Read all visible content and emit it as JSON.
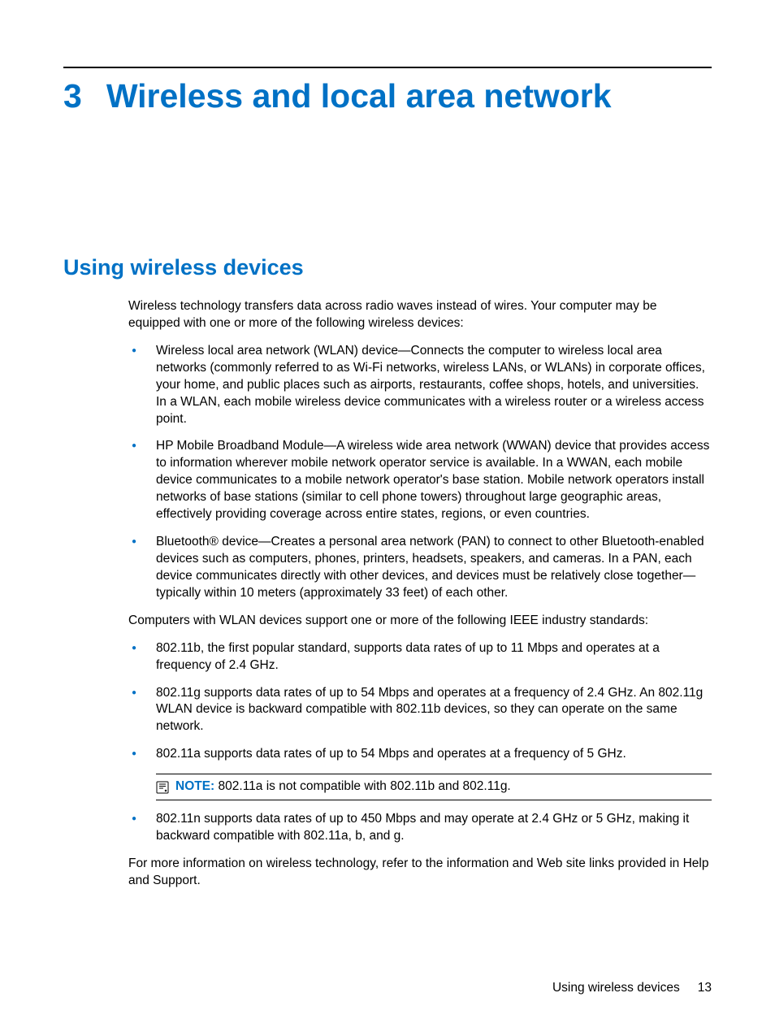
{
  "chapter": {
    "number": "3",
    "title": "Wireless and local area network"
  },
  "section": {
    "title": "Using wireless devices",
    "intro": "Wireless technology transfers data across radio waves instead of wires. Your computer may be equipped with one or more of the following wireless devices:",
    "devices": [
      "Wireless local area network (WLAN) device—Connects the computer to wireless local area networks (commonly referred to as Wi-Fi networks, wireless LANs, or WLANs) in corporate offices, your home, and public places such as airports, restaurants, coffee shops, hotels, and universities. In a WLAN, each mobile wireless device communicates with a wireless router or a wireless access point.",
      "HP Mobile Broadband Module—A wireless wide area network (WWAN) device that provides access to information wherever mobile network operator service is available. In a WWAN, each mobile device communicates to a mobile network operator's base station. Mobile network operators install networks of base stations (similar to cell phone towers) throughout large geographic areas, effectively providing coverage across entire states, regions, or even countries.",
      "Bluetooth® device—Creates a personal area network (PAN) to connect to other Bluetooth-enabled devices such as computers, phones, printers, headsets, speakers, and cameras. In a PAN, each device communicates directly with other devices, and devices must be relatively close together—typically within 10 meters (approximately 33 feet) of each other."
    ],
    "standards_intro": "Computers with WLAN devices support one or more of the following IEEE industry standards:",
    "standards": [
      "802.11b, the first popular standard, supports data rates of up to 11 Mbps and operates at a frequency of 2.4 GHz.",
      "802.11g supports data rates of up to 54 Mbps and operates at a frequency of 2.4 GHz. An 802.11g WLAN device is backward compatible with 802.11b devices, so they can operate on the same network.",
      "802.11a supports data rates of up to 54 Mbps and operates at a frequency of 5 GHz.",
      "802.11n supports data rates of up to 450 Mbps and may operate at 2.4 GHz or 5 GHz, making it backward compatible with 802.11a, b, and g."
    ],
    "note": {
      "label": "NOTE:",
      "text": "802.11a is not compatible with 802.11b and 802.11g."
    },
    "closing": "For more information on wireless technology, refer to the information and Web site links provided in Help and Support."
  },
  "footer": {
    "section_name": "Using wireless devices",
    "page_number": "13"
  }
}
